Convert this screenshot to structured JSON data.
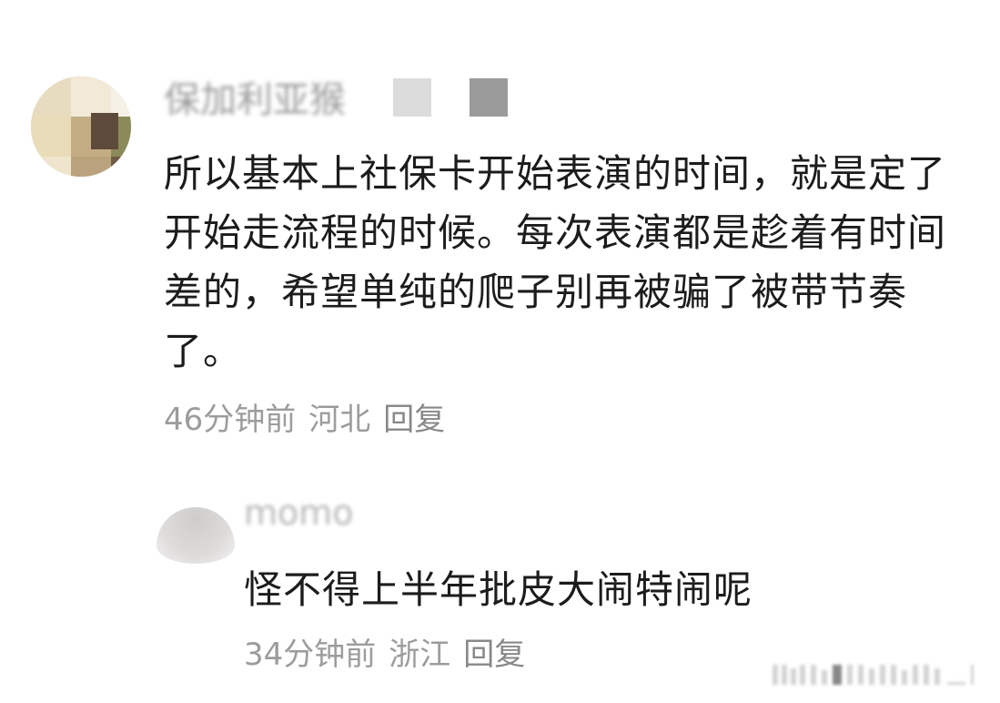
{
  "main_comment": {
    "username": "保加利亚猴",
    "text": "所以基本上社保卡开始表演的时间，就是定了开始走流程的时候。每次表演都是趁着有时间差的，希望单纯的爬子别再被骗了被带节奏了。",
    "time": "46分钟前",
    "location": "河北",
    "reply_label": "回复"
  },
  "reply_comment": {
    "username": "momo",
    "text": "怪不得上半年批皮大闹特闹呢",
    "time": "34分钟前",
    "location": "浙江",
    "reply_label": "回复"
  },
  "colors": {
    "text": "#1c1c1c",
    "meta": "#9c9c9c",
    "background": "#ffffff"
  }
}
